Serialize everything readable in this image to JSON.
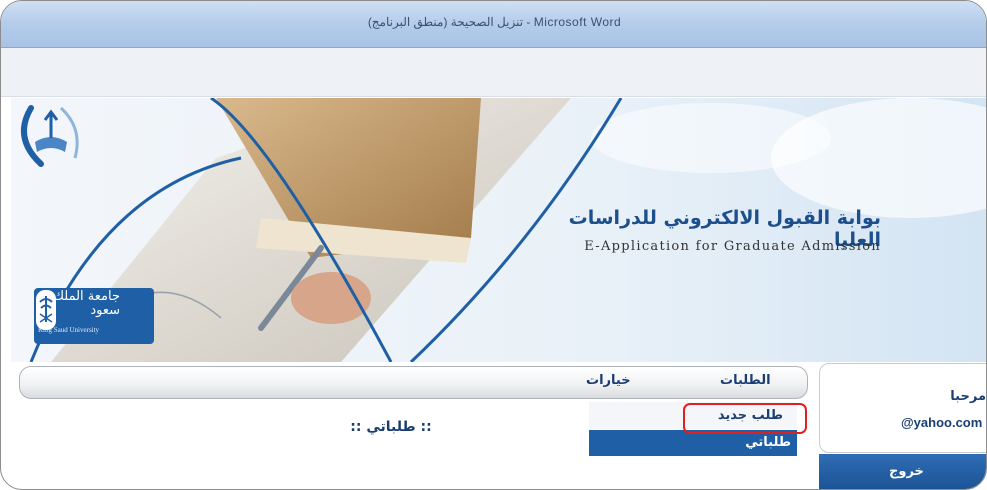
{
  "window": {
    "title": "تنزيل الصحيحة (منطق البرنامج) - Microsoft Word"
  },
  "banner": {
    "university_name_ar": "جامعة الملك سعود",
    "university_name_en": "King Saud University",
    "portal_title_ar": "بوابة القبول الالكتروني للدراسات العليا",
    "portal_title_en": "E-Application for Graduate Admission"
  },
  "menu": {
    "items": [
      {
        "label": "الطلبات"
      },
      {
        "label": "خيارات"
      }
    ],
    "submenu": {
      "new_request": "طلب جديد",
      "my_requests": "طلباتي"
    }
  },
  "main": {
    "heading": ":: طلباتي ::"
  },
  "user": {
    "welcome": "مرحبا",
    "email": "@yahoo.com",
    "logout_label": "خروج"
  },
  "colors": {
    "accent": "#1f5fa6",
    "highlight": "#e02020"
  }
}
